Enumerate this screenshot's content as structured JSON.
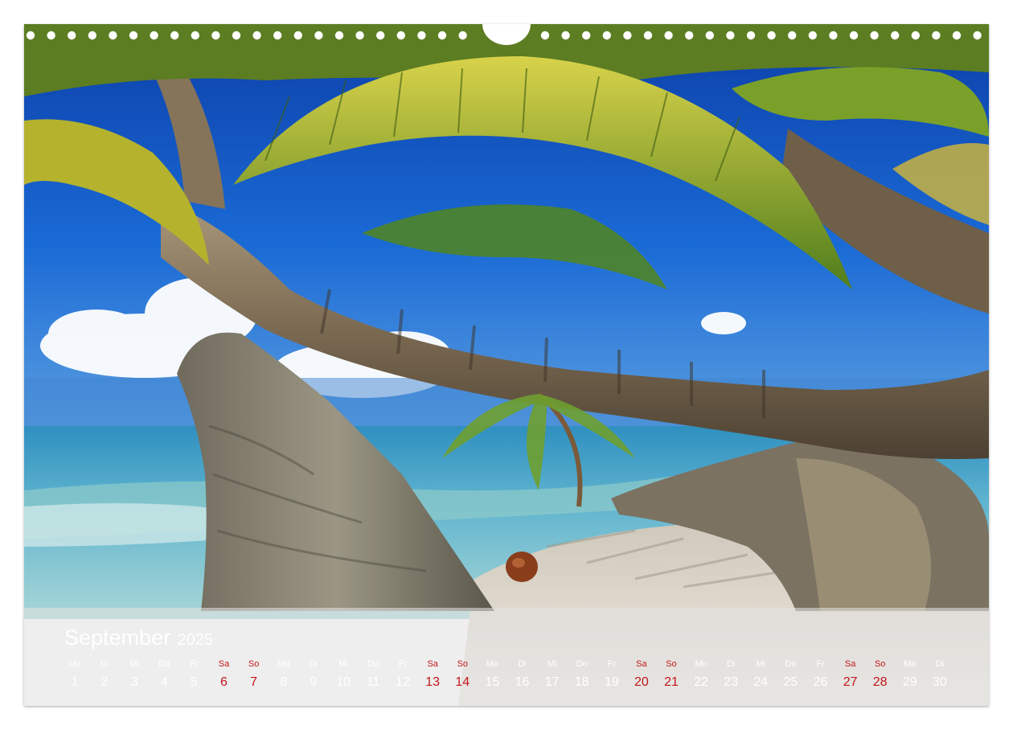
{
  "calendar": {
    "month": "September",
    "year": "2025",
    "weekdays": [
      "Mo",
      "Di",
      "Mi",
      "Do",
      "Fr",
      "Sa",
      "So",
      "Mo",
      "Di",
      "Mi",
      "Do",
      "Fr",
      "Sa",
      "So",
      "Mo",
      "Di",
      "Mi",
      "Do",
      "Fr",
      "Sa",
      "So",
      "Mo",
      "Di",
      "Mi",
      "Do",
      "Fr",
      "Sa",
      "So",
      "Mo",
      "Di"
    ],
    "days": [
      "1",
      "2",
      "3",
      "4",
      "5",
      "6",
      "7",
      "8",
      "9",
      "10",
      "11",
      "12",
      "13",
      "14",
      "15",
      "16",
      "17",
      "18",
      "19",
      "20",
      "21",
      "22",
      "23",
      "24",
      "25",
      "26",
      "27",
      "28",
      "29",
      "30"
    ],
    "weekend_color": "#c4161c",
    "text_color": "#ffffff"
  },
  "photo": {
    "subject": "palm-trees-tropical-beach",
    "colors": {
      "sky": "#1a5fc8",
      "sea": "#4aa7c9",
      "sand": "#e8e2d8",
      "trunk": "#8a7a62",
      "frond": "#9ab22a"
    }
  }
}
